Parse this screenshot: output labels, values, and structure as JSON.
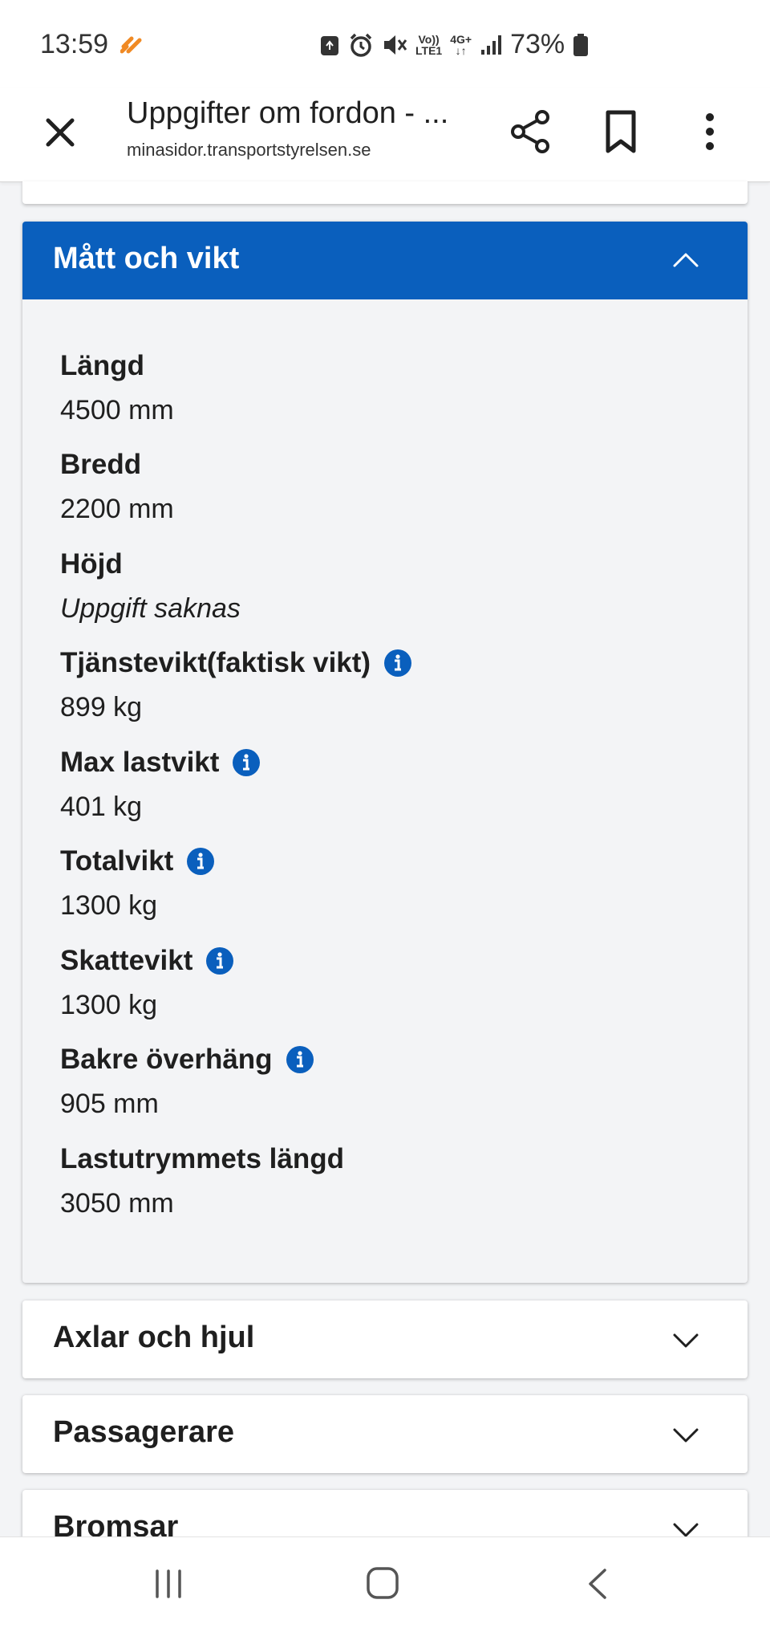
{
  "status_bar": {
    "time": "13:59",
    "network_top": "Vo))",
    "network_bottom": "LTE1",
    "data_top": "4G+",
    "data_bottom": "↓↑",
    "battery": "73%"
  },
  "browser": {
    "title": "Uppgifter om fordon - ...",
    "domain": "minasidor.transportstyrelsen.se"
  },
  "expanded_section": {
    "title": "Mått och vikt",
    "fields": [
      {
        "label": "Längd",
        "value": "4500 mm",
        "info": false
      },
      {
        "label": "Bredd",
        "value": "2200 mm",
        "info": false
      },
      {
        "label": "Höjd",
        "value": "Uppgift saknas",
        "info": false
      },
      {
        "label": "Tjänstevikt(faktisk vikt)",
        "value": "899 kg",
        "info": true
      },
      {
        "label": "Max lastvikt",
        "value": "401 kg",
        "info": true
      },
      {
        "label": "Totalvikt",
        "value": "1300 kg",
        "info": true
      },
      {
        "label": "Skattevikt",
        "value": "1300 kg",
        "info": true
      },
      {
        "label": "Bakre överhäng",
        "value": "905 mm",
        "info": true
      },
      {
        "label": "Lastutrymmets längd",
        "value": "3050 mm",
        "info": false
      }
    ]
  },
  "collapsed_sections": [
    {
      "title": "Axlar och hjul"
    },
    {
      "title": "Passagerare"
    },
    {
      "title": "Bromsar"
    }
  ],
  "colors": {
    "accent": "#0a5fbd",
    "page_bg": "#f3f4f6"
  }
}
